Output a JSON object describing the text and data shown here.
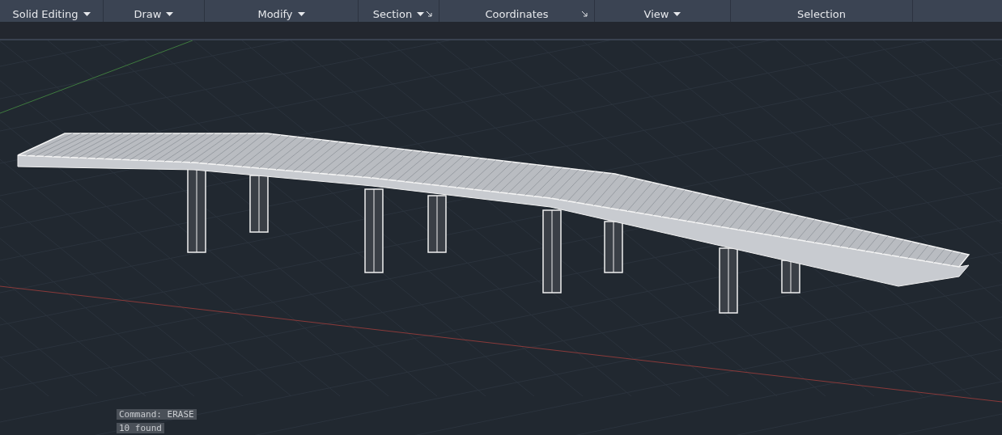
{
  "ribbon": {
    "panels": [
      {
        "label": "Solid Editing",
        "dropdown": true,
        "launcher": false
      },
      {
        "label": "Draw",
        "dropdown": true,
        "launcher": false
      },
      {
        "label": "Modify",
        "dropdown": true,
        "launcher": false
      },
      {
        "label": "Section",
        "dropdown": true,
        "launcher": true
      },
      {
        "label": "Coordinates",
        "dropdown": false,
        "launcher": true
      },
      {
        "label": "View",
        "dropdown": true,
        "launcher": false
      },
      {
        "label": "Selection",
        "dropdown": false,
        "launcher": false
      }
    ]
  },
  "command_history": [
    "Command: ERASE",
    "10 found"
  ]
}
